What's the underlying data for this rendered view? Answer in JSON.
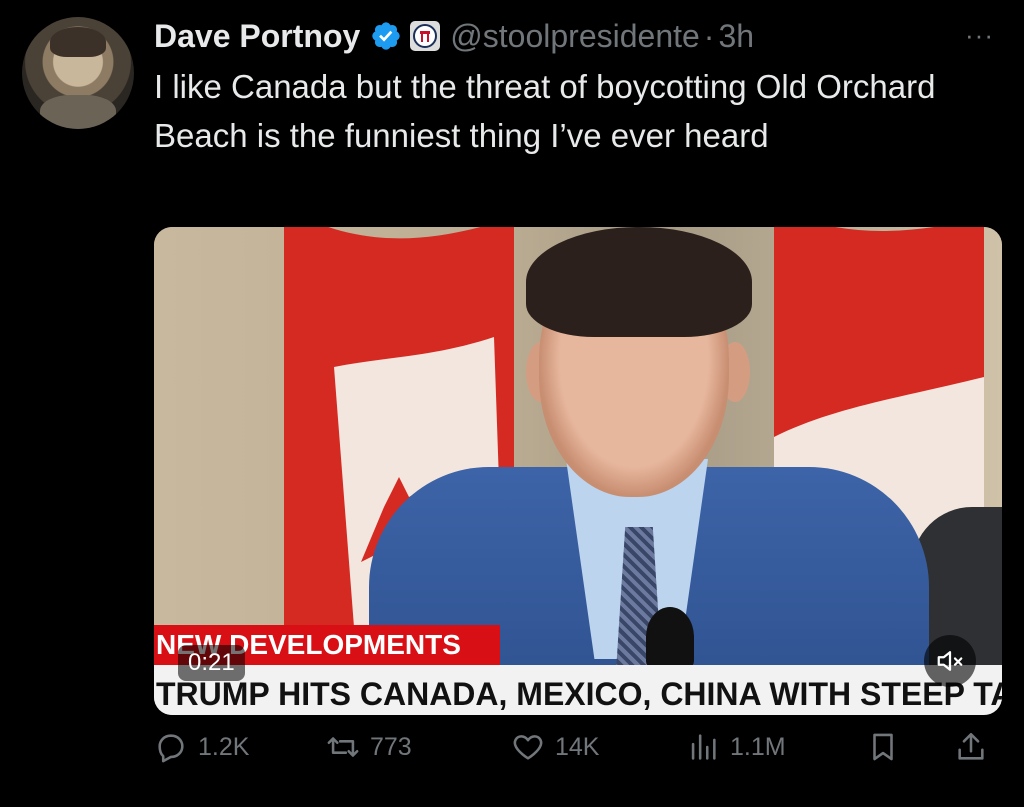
{
  "tweet": {
    "author_name": "Dave Portnoy",
    "handle": "@stoolpresidente",
    "separator": "·",
    "time": "3h",
    "more": "···",
    "text": "I like Canada but the threat of boycotting Old Orchard Beach is the funniest thing I’ve ever heard"
  },
  "video": {
    "lower_banner": "NEW DEVELOPMENTS",
    "ticker": "TRUMP HITS CANADA, MEXICO, CHINA WITH STEEP TARIFFS",
    "duration": "0:21",
    "muted": true
  },
  "actions": {
    "replies": "1.2K",
    "retweets": "773",
    "likes": "14K",
    "views": "1.1M"
  },
  "icons": {
    "verified": "verified-badge-icon",
    "org": "barstool-badge-icon",
    "reply": "reply-icon",
    "retweet": "retweet-icon",
    "like": "heart-icon",
    "views": "views-icon",
    "bookmark": "bookmark-icon",
    "share": "share-icon",
    "mute": "muted-speaker-icon"
  },
  "colors": {
    "background": "#000000",
    "text": "#e7e9ea",
    "secondary": "#71767b",
    "verified": "#1d9bf0",
    "news_red": "#d90f16"
  }
}
